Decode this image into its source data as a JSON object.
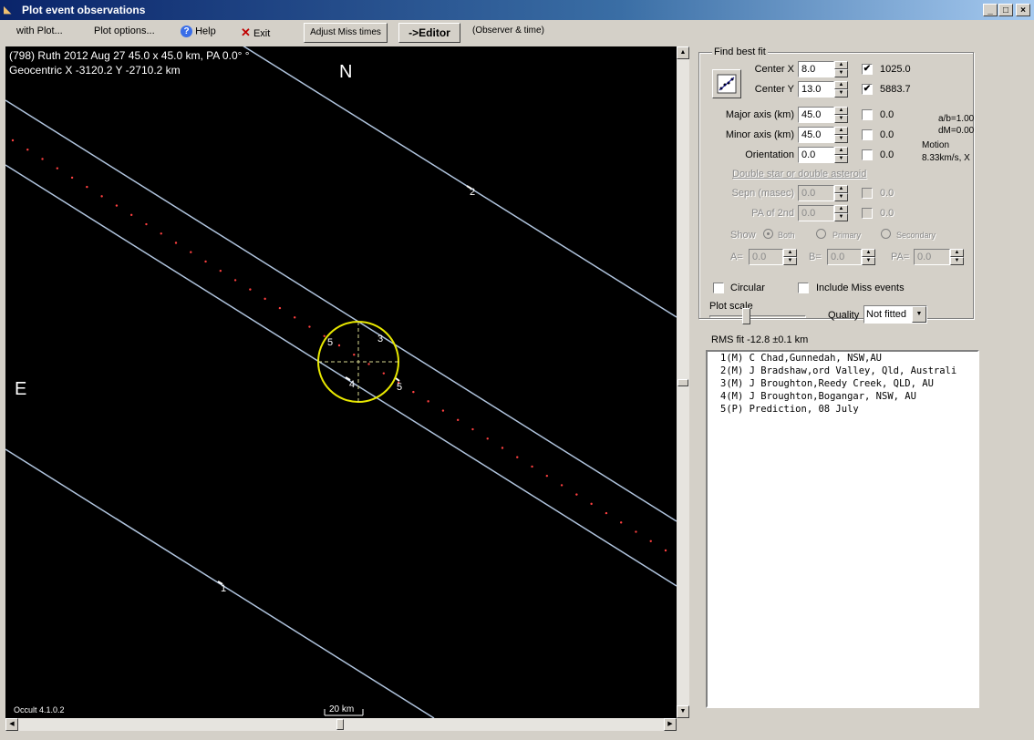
{
  "window": {
    "title": "Plot event observations",
    "controls": [
      "_",
      "□",
      "×"
    ]
  },
  "menu": {
    "with_plot": "with Plot...",
    "plot_options": "Plot options...",
    "help": "Help",
    "exit": "Exit",
    "adjust_miss": "Adjust Miss times",
    "editor": "->Editor",
    "observer_time": "(Observer & time)"
  },
  "plot": {
    "header_line1": "(798) Ruth  2012 Aug 27   45.0 x 45.0 km, PA 0.0° °",
    "header_line2": "Geocentric X -3120.2  Y -2710.2 km",
    "north": "N",
    "east": "E",
    "version": "Occult 4.1.0.2",
    "scale_bar": "20 km",
    "chord_labels": [
      "1",
      "2",
      "3",
      "4",
      "5",
      "5"
    ],
    "colors": {
      "background": "#000000",
      "chord": "#b0c4de",
      "ellipse": "#e8e800",
      "prediction": "#ff4040"
    }
  },
  "fit_panel": {
    "group_title": "Find best fit",
    "center_x_label": "Center X",
    "center_x_value": "8.0",
    "center_x_checked": "✔",
    "center_x_result": "1025.0",
    "center_y_label": "Center Y",
    "center_y_value": "13.0",
    "center_y_checked": "✔",
    "center_y_result": "5883.7",
    "major_label": "Major axis (km)",
    "major_value": "45.0",
    "major_result": "0.0",
    "minor_label": "Minor axis (km)",
    "minor_value": "45.0",
    "minor_result": "0.0",
    "orient_label": "Orientation",
    "orient_value": "0.0",
    "orient_result": "0.0",
    "ab_ratio": "a/b=1.00",
    "dm": "dM=0.00",
    "motion_label": "Motion",
    "motion_value": "8.33km/s, X",
    "double_title": "Double star  or  double asteroid",
    "sepn_label": "Sepn (masec)",
    "sepn_value": "0.0",
    "sepn_result": "0.0",
    "pa2_label": "PA of 2nd",
    "pa2_value": "0.0",
    "pa2_result": "0.0",
    "show_label": "Show",
    "show_both": "Both",
    "show_primary": "Primary",
    "show_secondary": "Secondary",
    "a_label": "A=",
    "a_value": "0.0",
    "b_label": "B=",
    "b_value": "0.0",
    "pa_label": "PA=",
    "pa_value": "0.0"
  },
  "options": {
    "circular": "Circular",
    "include_miss": "Include Miss events",
    "plot_scale": "Plot scale",
    "quality_label": "Quality",
    "quality_value": "Not fitted",
    "rms_fit": "RMS fit -12.8 ±0.1 km"
  },
  "observers": [
    "1(M) C Chad,Gunnedah, NSW,AU",
    "2(M) J Bradshaw,ord Valley, Qld, Australi",
    "3(M) J Broughton,Reedy Creek, QLD, AU",
    "4(M) J Broughton,Bogangar, NSW, AU",
    "5(P) Prediction, 08 July"
  ]
}
